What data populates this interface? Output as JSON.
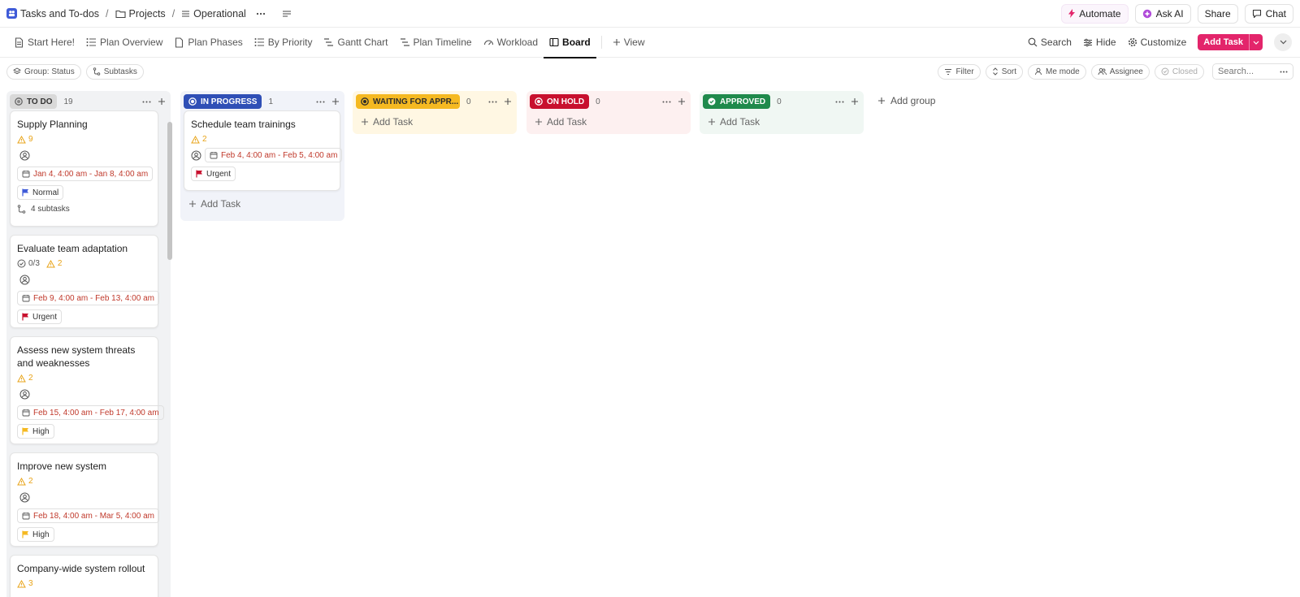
{
  "breadcrumbs": {
    "workspace": "Tasks and To-dos",
    "folder": "Projects",
    "list": "Operational"
  },
  "top_actions": {
    "automate": "Automate",
    "ask_ai": "Ask AI",
    "share": "Share",
    "chat": "Chat"
  },
  "views": {
    "tabs": [
      "Start Here!",
      "Plan Overview",
      "Plan Phases",
      "By Priority",
      "Gantt Chart",
      "Plan Timeline",
      "Workload",
      "Board"
    ],
    "add_view": "View",
    "search": "Search",
    "hide": "Hide",
    "customize": "Customize",
    "add_task": "Add Task"
  },
  "filters": {
    "group": "Group: Status",
    "subtasks": "Subtasks",
    "filter": "Filter",
    "sort": "Sort",
    "me_mode": "Me mode",
    "assignee": "Assignee",
    "closed": "Closed",
    "search_placeholder": "Search..."
  },
  "columns": [
    {
      "label": "TO DO",
      "count": "19",
      "color": "#d9d9d9",
      "text_color": "#333333",
      "bg": "#f1f2f4"
    },
    {
      "label": "IN PROGRESS",
      "count": "1",
      "color": "#2f4fb6",
      "text_color": "#ffffff",
      "bg": "#f1f3f9"
    },
    {
      "label": "WAITING FOR APPR...",
      "count": "0",
      "color": "#f5b921",
      "text_color": "#2b2b2b",
      "bg": "#fff7e3"
    },
    {
      "label": "ON HOLD",
      "count": "0",
      "color": "#c8102e",
      "text_color": "#ffffff",
      "bg": "#fdf0f0"
    },
    {
      "label": "APPROVED",
      "count": "0",
      "color": "#1f8a4c",
      "text_color": "#ffffff",
      "bg": "#f0f7f3"
    }
  ],
  "add_task_label": "Add Task",
  "add_group_label": "Add group",
  "todo_cards": [
    {
      "title": "Supply Planning",
      "checklist": "",
      "warn": "9",
      "date": "Jan 4, 4:00 am - Jan 8, 4:00 am",
      "priority": "Normal",
      "priority_color": "#3f5bd8",
      "subtasks": "4 subtasks"
    },
    {
      "title": "Evaluate team adaptation",
      "checklist": "0/3",
      "warn": "2",
      "date": "Feb 9, 4:00 am - Feb 13, 4:00 am",
      "priority": "Urgent",
      "priority_color": "#c8102e",
      "subtasks": ""
    },
    {
      "title": "Assess new system threats and weaknesses",
      "checklist": "",
      "warn": "2",
      "date": "Feb 15, 4:00 am - Feb 17, 4:00 am",
      "priority": "High",
      "priority_color": "#f5b921",
      "subtasks": ""
    },
    {
      "title": "Improve new system",
      "checklist": "",
      "warn": "2",
      "date": "Feb 18, 4:00 am - Mar 5, 4:00 am",
      "priority": "High",
      "priority_color": "#f5b921",
      "subtasks": ""
    },
    {
      "title": "Company-wide system rollout",
      "checklist": "",
      "warn": "3",
      "date": "",
      "priority": "",
      "priority_color": "",
      "subtasks": ""
    }
  ],
  "inprogress_cards": [
    {
      "title": "Schedule team trainings",
      "warn": "2",
      "date": "Feb 4, 4:00 am - Feb 5, 4:00 am",
      "priority": "Urgent",
      "priority_color": "#c8102e"
    }
  ],
  "icons": {
    "workspace": "people-icon",
    "folder": "folder-icon",
    "list": "list-icon",
    "warning": "warning-triangle-icon",
    "assignee": "user-circle-icon",
    "calendar": "calendar-icon",
    "flag": "flag-icon",
    "subtask": "subtask-icon"
  }
}
